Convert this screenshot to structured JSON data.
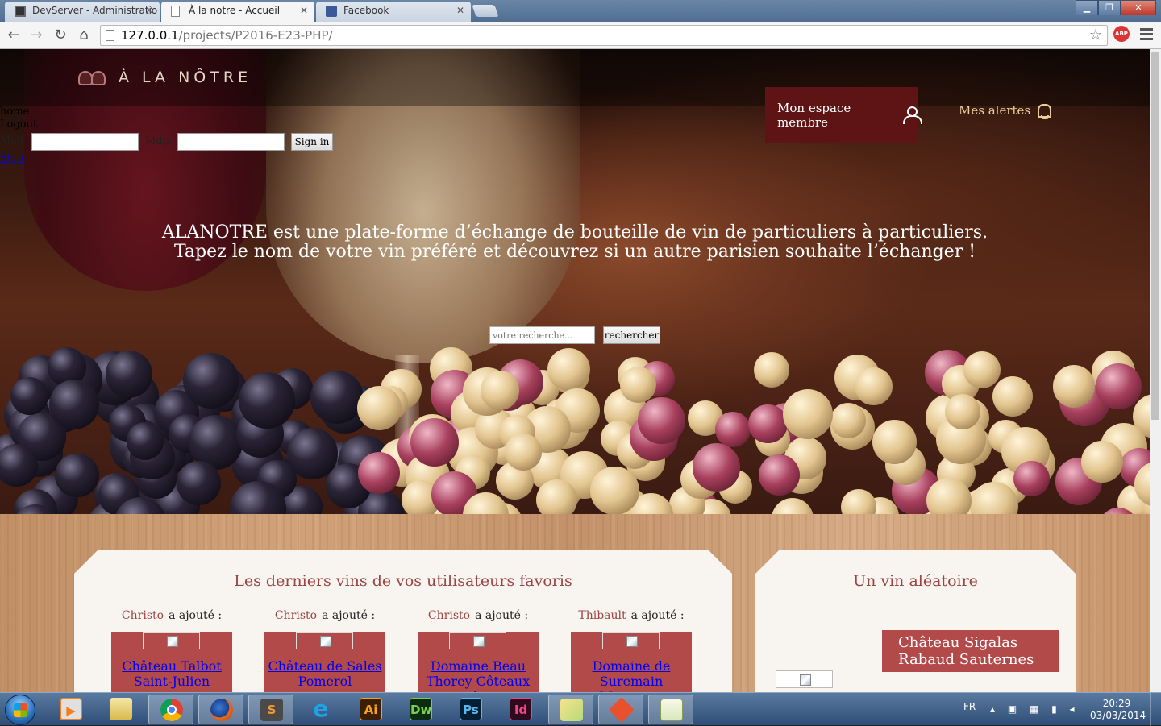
{
  "browser": {
    "tabs": [
      {
        "label": "DevServer - Administratio",
        "active": false,
        "icon": "server-icon"
      },
      {
        "label": "À la notre - Accueil",
        "active": true,
        "icon": "page-icon"
      },
      {
        "label": "Facebook",
        "active": false,
        "icon": "facebook-icon"
      }
    ],
    "tab_close": "✕",
    "url_host": "127.0.0.1",
    "url_path": "/projects/P2016-E23-PHP/",
    "abp_label": "ABP",
    "window_buttons": {
      "minimize": "▁",
      "maximize": "❐",
      "close": "✕"
    }
  },
  "header": {
    "logo_text": "À LA NÔTRE",
    "member_button": "Mon espace membre",
    "alerts_link": "Mes alertes",
    "raw_links": [
      "home",
      "Logout"
    ],
    "login": {
      "mail_label": "Mail",
      "pass_label": "Mdp",
      "mail_value": "",
      "pass_value": "",
      "submit": "Sign in"
    },
    "sign_link": "Sign"
  },
  "hero": {
    "text": "ALANOTRE est une plate-forme d’échange de bouteille de vin de particuliers à particuliers. Tapez le nom de votre vin préféré et découvrez si un autre parisien souhaite l’échanger !",
    "search_placeholder": "votre recherche...",
    "search_button": "rechercher"
  },
  "favorites": {
    "title": "Les derniers vins de vos utilisateurs favoris",
    "added_text": "a ajouté :",
    "items": [
      {
        "user": "Christo",
        "wine": "Château Talbot Saint-Julien"
      },
      {
        "user": "Christo",
        "wine": "Château de Sales Pomerol"
      },
      {
        "user": "Christo",
        "wine": "Domaine Beau Thorey Côteaux du"
      },
      {
        "user": "Thibault",
        "wine": "Domaine de Suremain Mercurey"
      }
    ]
  },
  "random": {
    "title": "Un vin aléatoire",
    "wine": "Château Sigalas Rabaud Sauternes"
  },
  "taskbar": {
    "apps": [
      "Windows Explorer",
      "Media Player",
      "Files",
      "Chrome",
      "Firefox",
      "Sublime Text",
      "Internet Explorer",
      "Illustrator",
      "Dreamweaver",
      "Photoshop",
      "InDesign",
      "Folders",
      "Git",
      "Notepad++"
    ],
    "app_glyphs": {
      "s": "S",
      "ai": "Ai",
      "dw": "Dw",
      "ps": "Ps",
      "id": "Id",
      "e": "e"
    },
    "lang": "FR",
    "time": "20:29",
    "date": "03/03/2014"
  },
  "colors": {
    "brand_red": "#5e1414",
    "card_red": "#b34a4a",
    "title_red": "#9a4444",
    "alert_gold": "#e8cf9a"
  }
}
